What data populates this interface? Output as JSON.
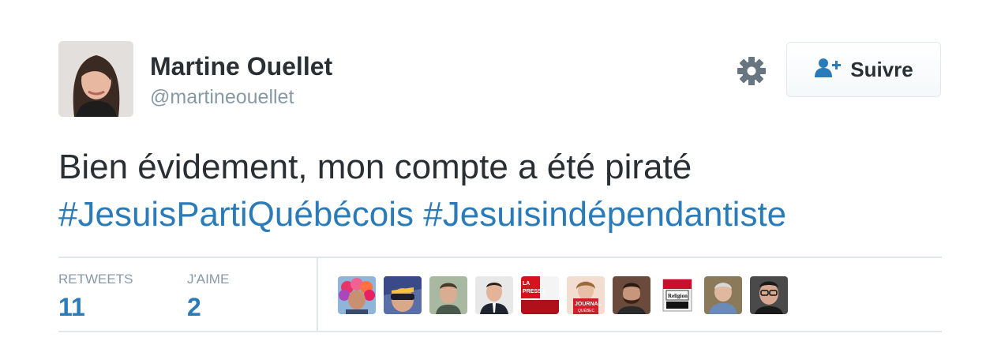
{
  "user": {
    "name": "Martine Ouellet",
    "handle": "@martineouellet"
  },
  "actions": {
    "follow_label": "Suivre",
    "follow_icon": "add-user-icon",
    "settings_icon": "gear-icon"
  },
  "tweet": {
    "text": "Bien évidement, mon compte a été piraté",
    "hashtags": [
      "#JesuisPartiQuébécois",
      "#Jesuisindépendantiste"
    ]
  },
  "stats": {
    "retweets_label": "RETWEETS",
    "retweets_count": "11",
    "likes_label": "J'AIME",
    "likes_count": "2"
  },
  "likers": [
    {
      "name": "liker-clown-wig"
    },
    {
      "name": "liker-sunglasses"
    },
    {
      "name": "liker-man-outdoor"
    },
    {
      "name": "liker-man-suit"
    },
    {
      "name": "liker-la-presse",
      "logo_text": "LA PRESSE"
    },
    {
      "name": "liker-journal-de-quebec",
      "logo_text": "JOURNAL DE QUÉBEC"
    },
    {
      "name": "liker-man-beard"
    },
    {
      "name": "liker-religion-pack",
      "logo_text": "Religion"
    },
    {
      "name": "liker-older-man"
    },
    {
      "name": "liker-man-glasses"
    }
  ],
  "colors": {
    "hashtag": "#2b7bb9",
    "text": "#292f33",
    "muted": "#8899a6",
    "border": "#e1e8ed"
  }
}
